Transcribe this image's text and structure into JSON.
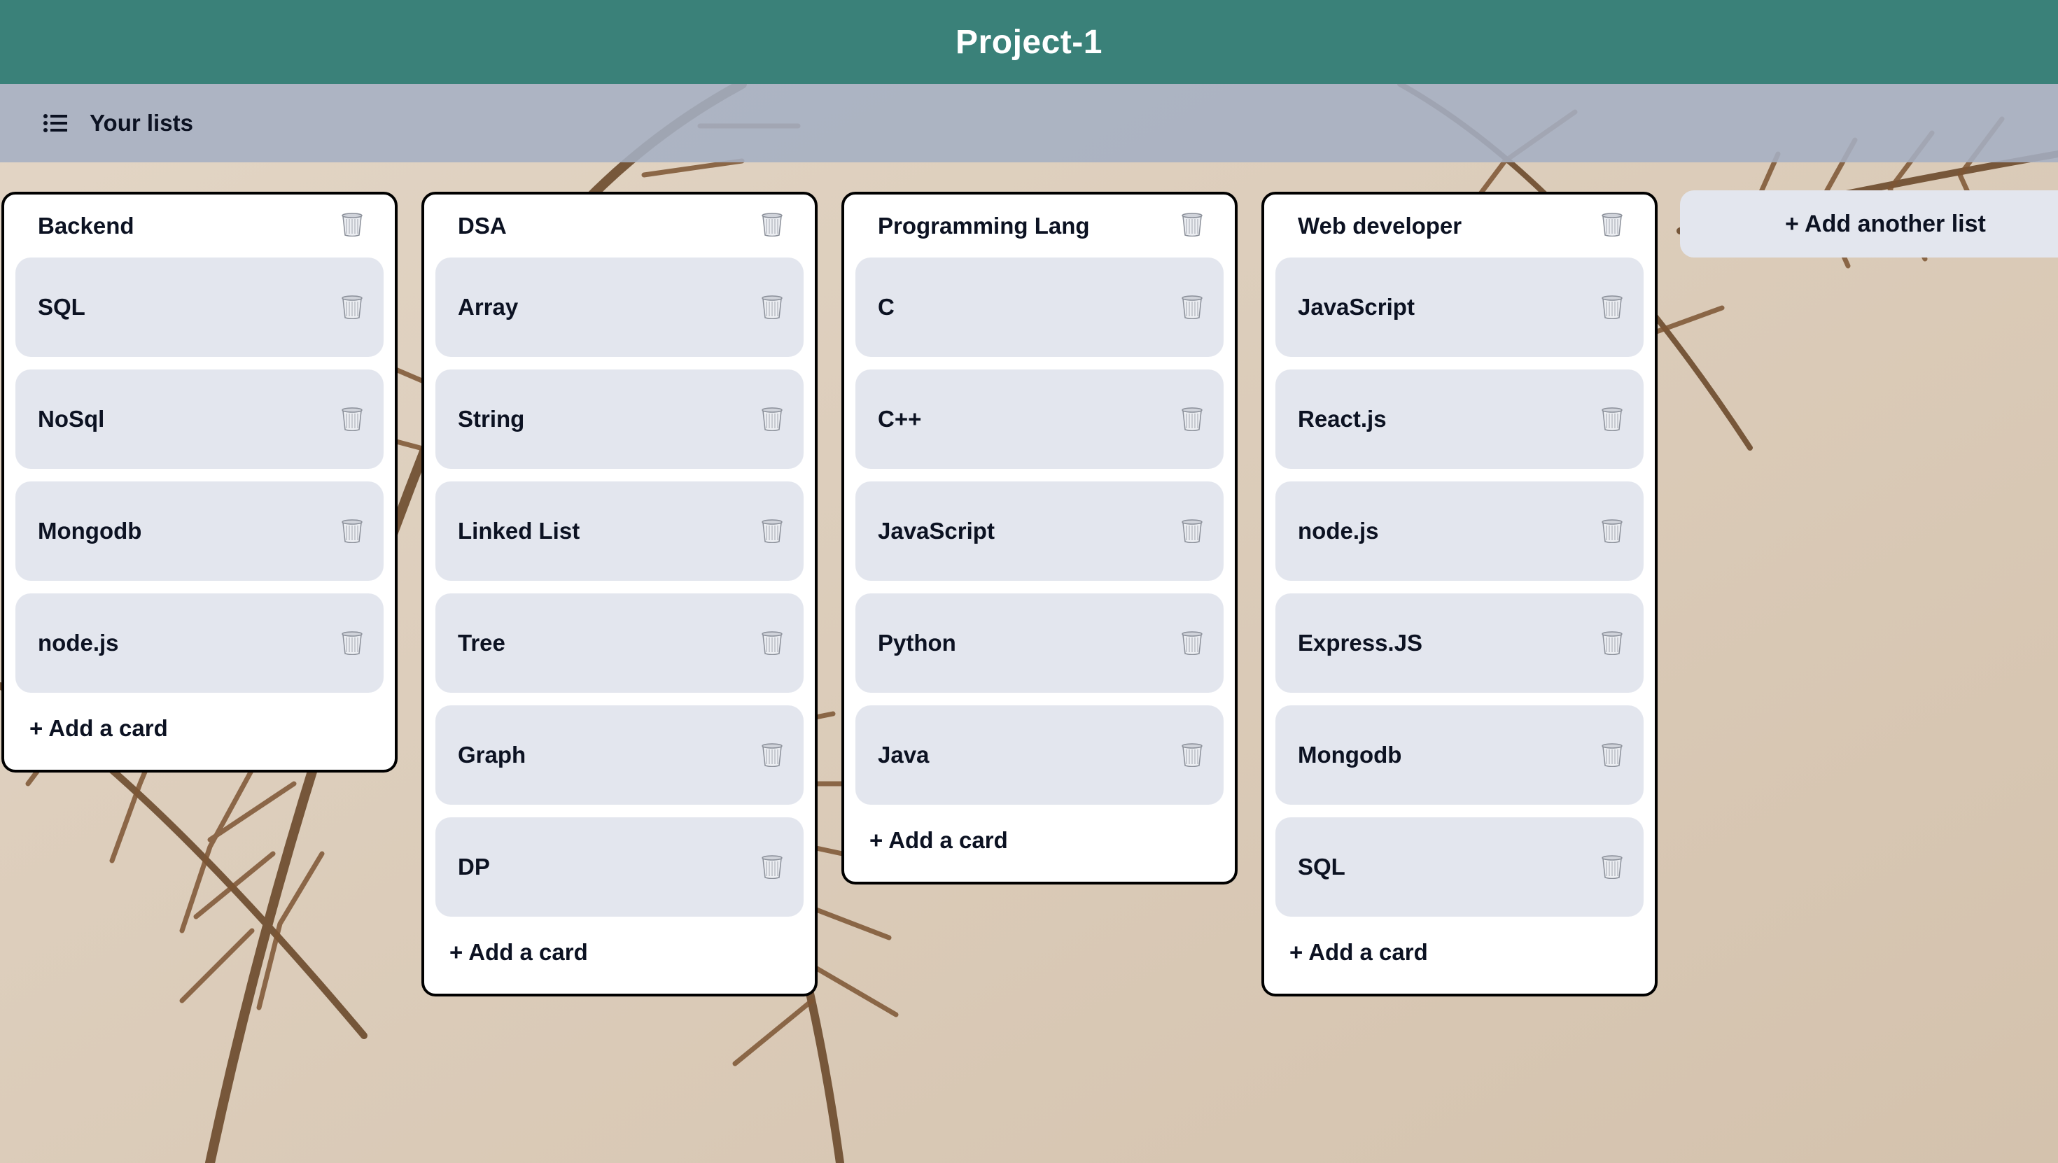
{
  "header": {
    "title": "Project-1"
  },
  "toolbar": {
    "lists_label": "Your lists",
    "lists_icon": "list-icon"
  },
  "board": {
    "lists": [
      {
        "title": "Backend",
        "cards": [
          "SQL",
          "NoSql",
          "Mongodb",
          "node.js"
        ],
        "add_card_label": "+ Add a card"
      },
      {
        "title": "DSA",
        "cards": [
          "Array",
          "String",
          "Linked List",
          "Tree",
          "Graph",
          "DP"
        ],
        "add_card_label": "+ Add a card"
      },
      {
        "title": "Programming Lang",
        "cards": [
          "C",
          "C++",
          "JavaScript",
          "Python",
          "Java"
        ],
        "add_card_label": "+ Add a card"
      },
      {
        "title": "Web developer",
        "cards": [
          "JavaScript",
          "React.js",
          "node.js",
          "Express.JS",
          "Mongodb",
          "SQL"
        ],
        "add_card_label": "+ Add a card"
      }
    ],
    "add_list_label": "+ Add another list"
  },
  "icons": {
    "delete": "trash-icon"
  },
  "colors": {
    "header_bg": "#3a8179",
    "card_bg": "#e3e6ee",
    "list_bg": "#ffffff",
    "text": "#0c1222"
  }
}
